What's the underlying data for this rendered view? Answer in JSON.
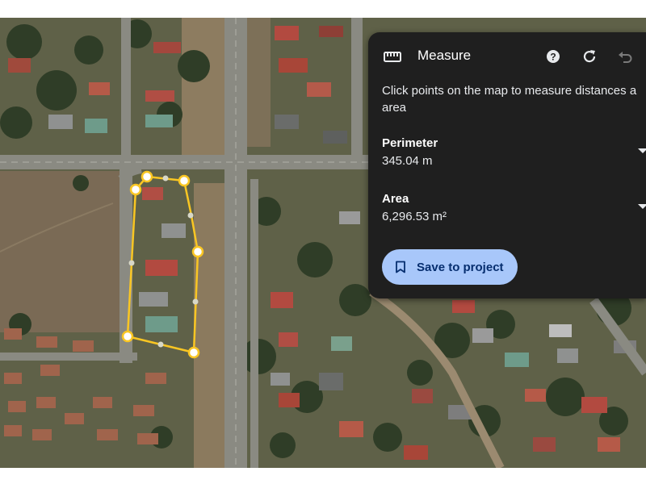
{
  "panel": {
    "title": "Measure",
    "title_icon": "ruler-icon",
    "icons": {
      "help": "help-icon",
      "reset": "reset-icon",
      "undo": "undo-icon"
    },
    "instructions_line1": "Click points on the map to measure distances a",
    "instructions_line2": "area",
    "perimeter": {
      "label": "Perimeter",
      "value": "345.04 m"
    },
    "area": {
      "label": "Area",
      "value": "6,296.53 m²"
    },
    "save_button": {
      "label": "Save to project",
      "icon": "bookmark-icon"
    }
  },
  "colors": {
    "panel_bg": "#1f1f1f",
    "button_bg": "#a8c7fa",
    "button_text": "#062e6f",
    "measure_line": "#f9c623",
    "vertex_fill": "#ffffff"
  },
  "measurement_points": 11
}
